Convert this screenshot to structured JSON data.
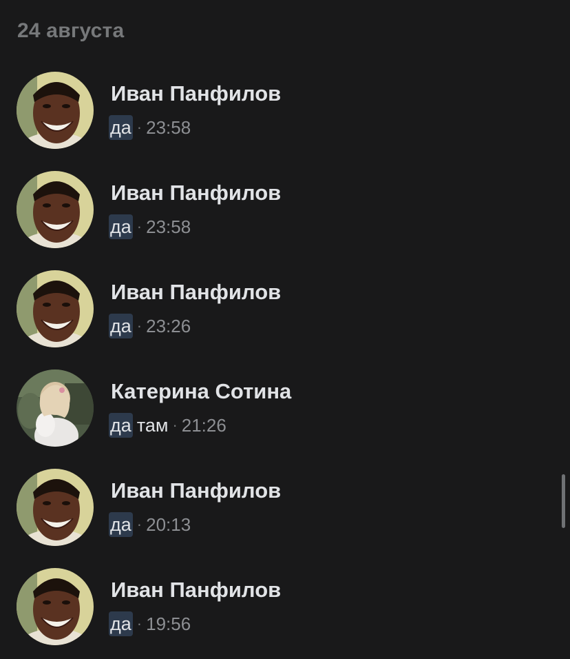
{
  "date_header": "24 августа",
  "results": [
    {
      "name": "Иван Панфилов",
      "highlight": "да",
      "rest": "",
      "separator": "·",
      "time": "23:58",
      "avatar": "man-photo"
    },
    {
      "name": "Иван Панфилов",
      "highlight": "да",
      "rest": "",
      "separator": "·",
      "time": "23:58",
      "avatar": "man-photo"
    },
    {
      "name": "Иван Панфилов",
      "highlight": "да",
      "rest": "",
      "separator": "·",
      "time": "23:26",
      "avatar": "man-photo"
    },
    {
      "name": "Катерина Сотина",
      "highlight": "да",
      "rest": "там",
      "separator": "·",
      "time": "21:26",
      "avatar": "girl-photo"
    },
    {
      "name": "Иван Панфилов",
      "highlight": "да",
      "rest": "",
      "separator": "·",
      "time": "20:13",
      "avatar": "man-photo"
    },
    {
      "name": "Иван Панфилов",
      "highlight": "да",
      "rest": "",
      "separator": "·",
      "time": "19:56",
      "avatar": "man-photo"
    }
  ],
  "colors": {
    "background": "#19191a",
    "highlight": "#2d3a4c",
    "secondary_text": "#76787a",
    "primary_text": "#e1e3e6"
  }
}
